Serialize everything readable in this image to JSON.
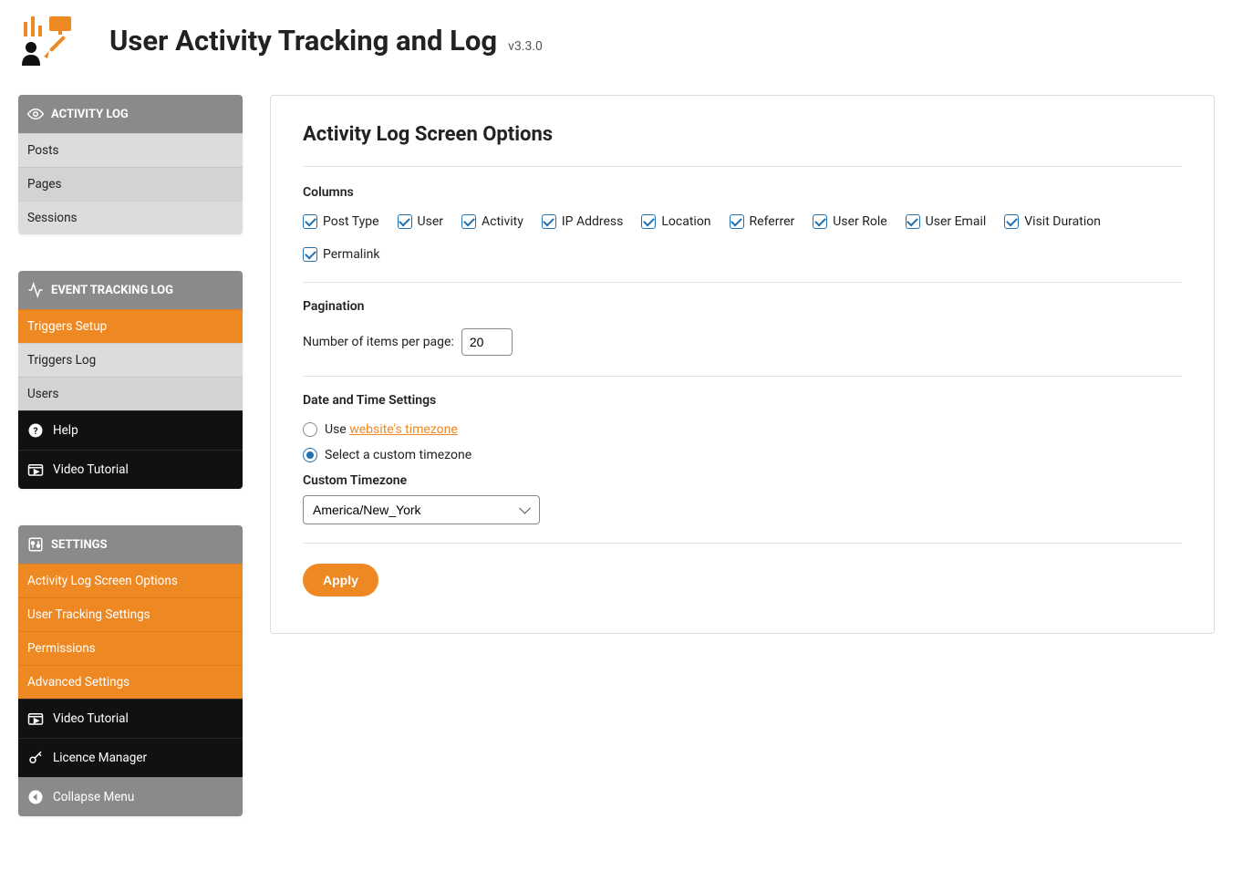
{
  "header": {
    "title": "User Activity Tracking and Log",
    "version": "v3.3.0"
  },
  "sidebar": {
    "group_activity": {
      "title": "ACTIVITY LOG",
      "items": [
        "Posts",
        "Pages",
        "Sessions"
      ]
    },
    "group_event": {
      "title": "EVENT TRACKING LOG",
      "items": [
        "Triggers Setup",
        "Triggers Log",
        "Users"
      ],
      "help": "Help",
      "video": "Video Tutorial"
    },
    "group_settings": {
      "title": "SETTINGS",
      "items": [
        "Activity Log Screen Options",
        "User Tracking Settings",
        "Permissions",
        "Advanced Settings"
      ],
      "video": "Video Tutorial",
      "licence": "Licence Manager",
      "collapse": "Collapse Menu"
    }
  },
  "content": {
    "title": "Activity Log Screen Options",
    "columns_label": "Columns",
    "columns": [
      "Post Type",
      "User",
      "Activity",
      "IP Address",
      "Location",
      "Referrer",
      "User Role",
      "User Email",
      "Visit Duration",
      "Permalink"
    ],
    "pagination_label": "Pagination",
    "pagination_text": "Number of items per page:",
    "pagination_value": "20",
    "datetime_label": "Date and Time Settings",
    "radio_use_prefix": "Use ",
    "radio_use_link": "website's timezone",
    "radio_custom": "Select a custom timezone",
    "tz_label": "Custom Timezone",
    "tz_value": "America/New_York",
    "apply": "Apply"
  }
}
